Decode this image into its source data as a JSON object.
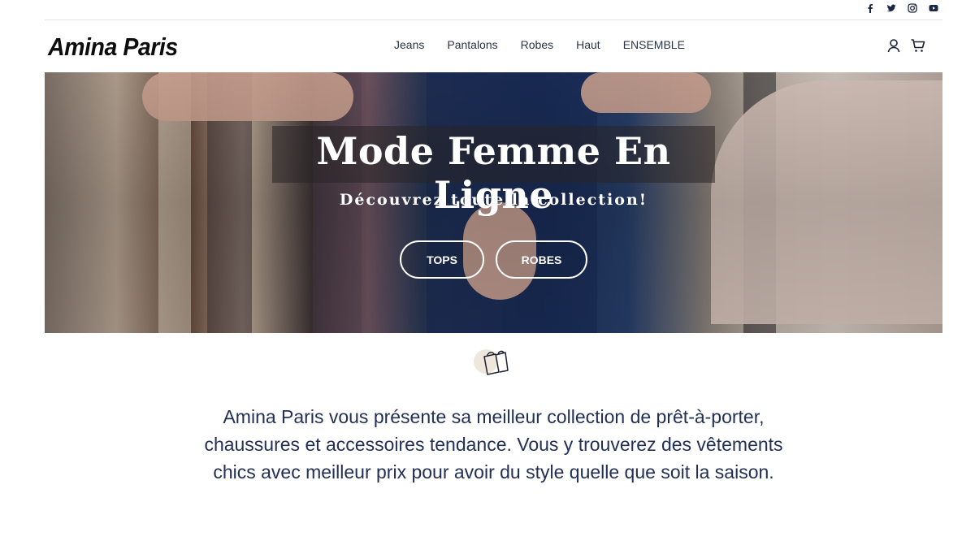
{
  "brand": {
    "name": "Amina Paris"
  },
  "social": [
    "facebook-icon",
    "twitter-icon",
    "instagram-icon",
    "youtube-icon"
  ],
  "nav": {
    "items": [
      "Jeans",
      "Pantalons",
      "Robes",
      "Haut",
      "ENSEMBLE"
    ]
  },
  "header_icons": [
    "user-icon",
    "cart-icon"
  ],
  "hero": {
    "title": "Mode Femme En Ligne",
    "subtitle": "Découvrez toute la collection!",
    "buttons": [
      "TOPS",
      "ROBES"
    ]
  },
  "intro": {
    "icon": "shopping-bags-icon",
    "text": "Amina Paris vous présente sa meilleur collection de prêt-à-porter, chaussures et accessoires tendance. Vous y trouverez des vêtements chics avec meilleur prix pour avoir du style quelle que soit la saison."
  },
  "colors": {
    "text": "#233056",
    "nav_text": "#2b3447",
    "logo": "#0d0d0d",
    "hero_text": "#ffffff",
    "social_icon": "#1a2744"
  }
}
